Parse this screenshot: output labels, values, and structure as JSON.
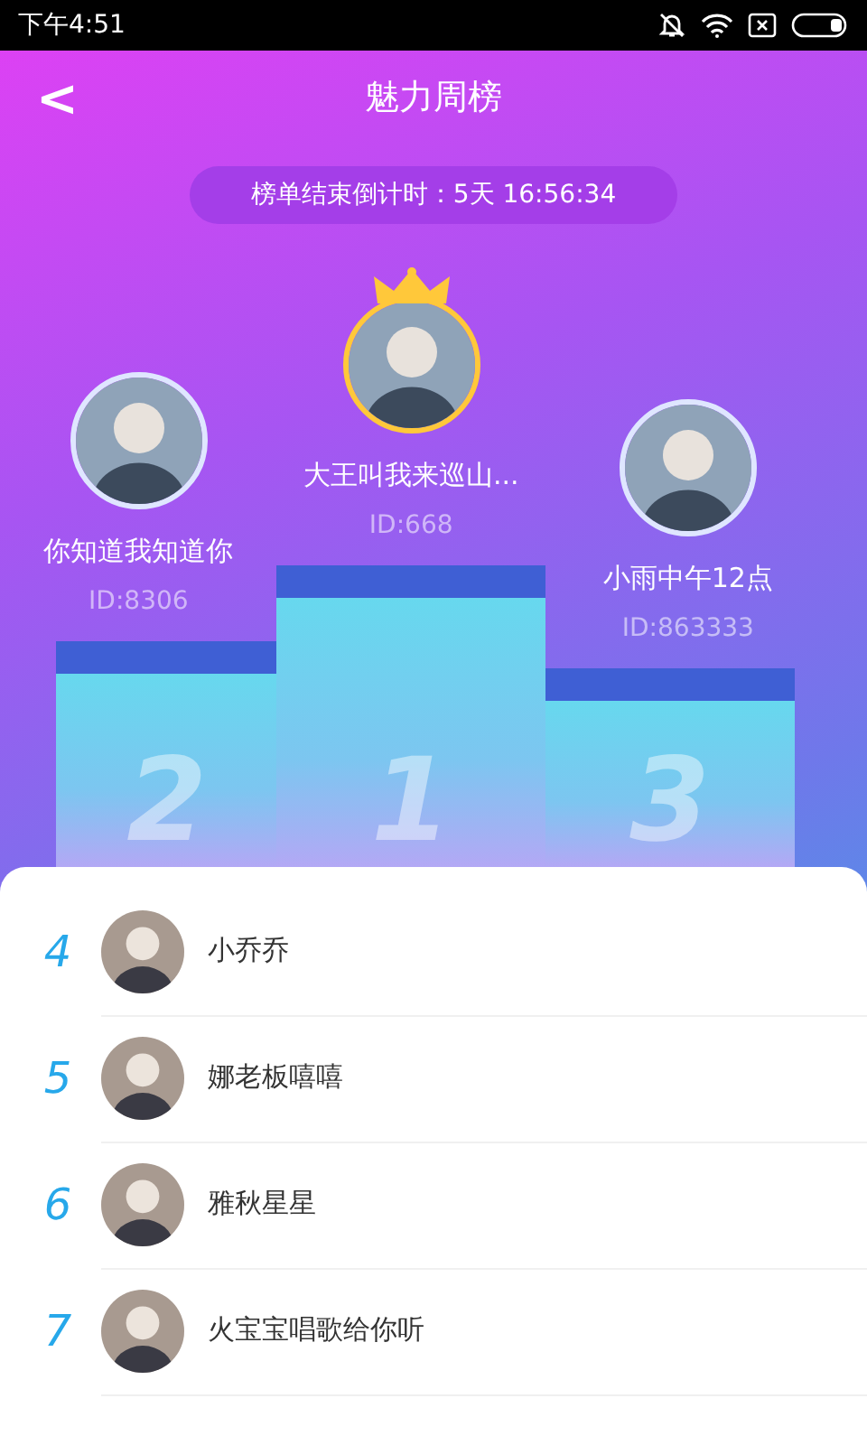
{
  "status_bar": {
    "time": "下午4:51"
  },
  "header": {
    "back": "<",
    "title": "魅力周榜"
  },
  "countdown": "榜单结束倒计时：5天 16:56:34",
  "podium": [
    {
      "place": "2",
      "name": "你知道我知道你",
      "id": "ID:8306",
      "crowned": false
    },
    {
      "place": "1",
      "name": "大王叫我来巡山...",
      "id": "ID:668",
      "crowned": true
    },
    {
      "place": "3",
      "name": "小雨中午12点",
      "id": "ID:863333",
      "crowned": false
    }
  ],
  "ranking": [
    {
      "rank": "4",
      "name": "小乔乔"
    },
    {
      "rank": "5",
      "name": "娜老板嘻嘻"
    },
    {
      "rank": "6",
      "name": "雅秋星星"
    },
    {
      "rank": "7",
      "name": "火宝宝唱歌给你听"
    }
  ]
}
